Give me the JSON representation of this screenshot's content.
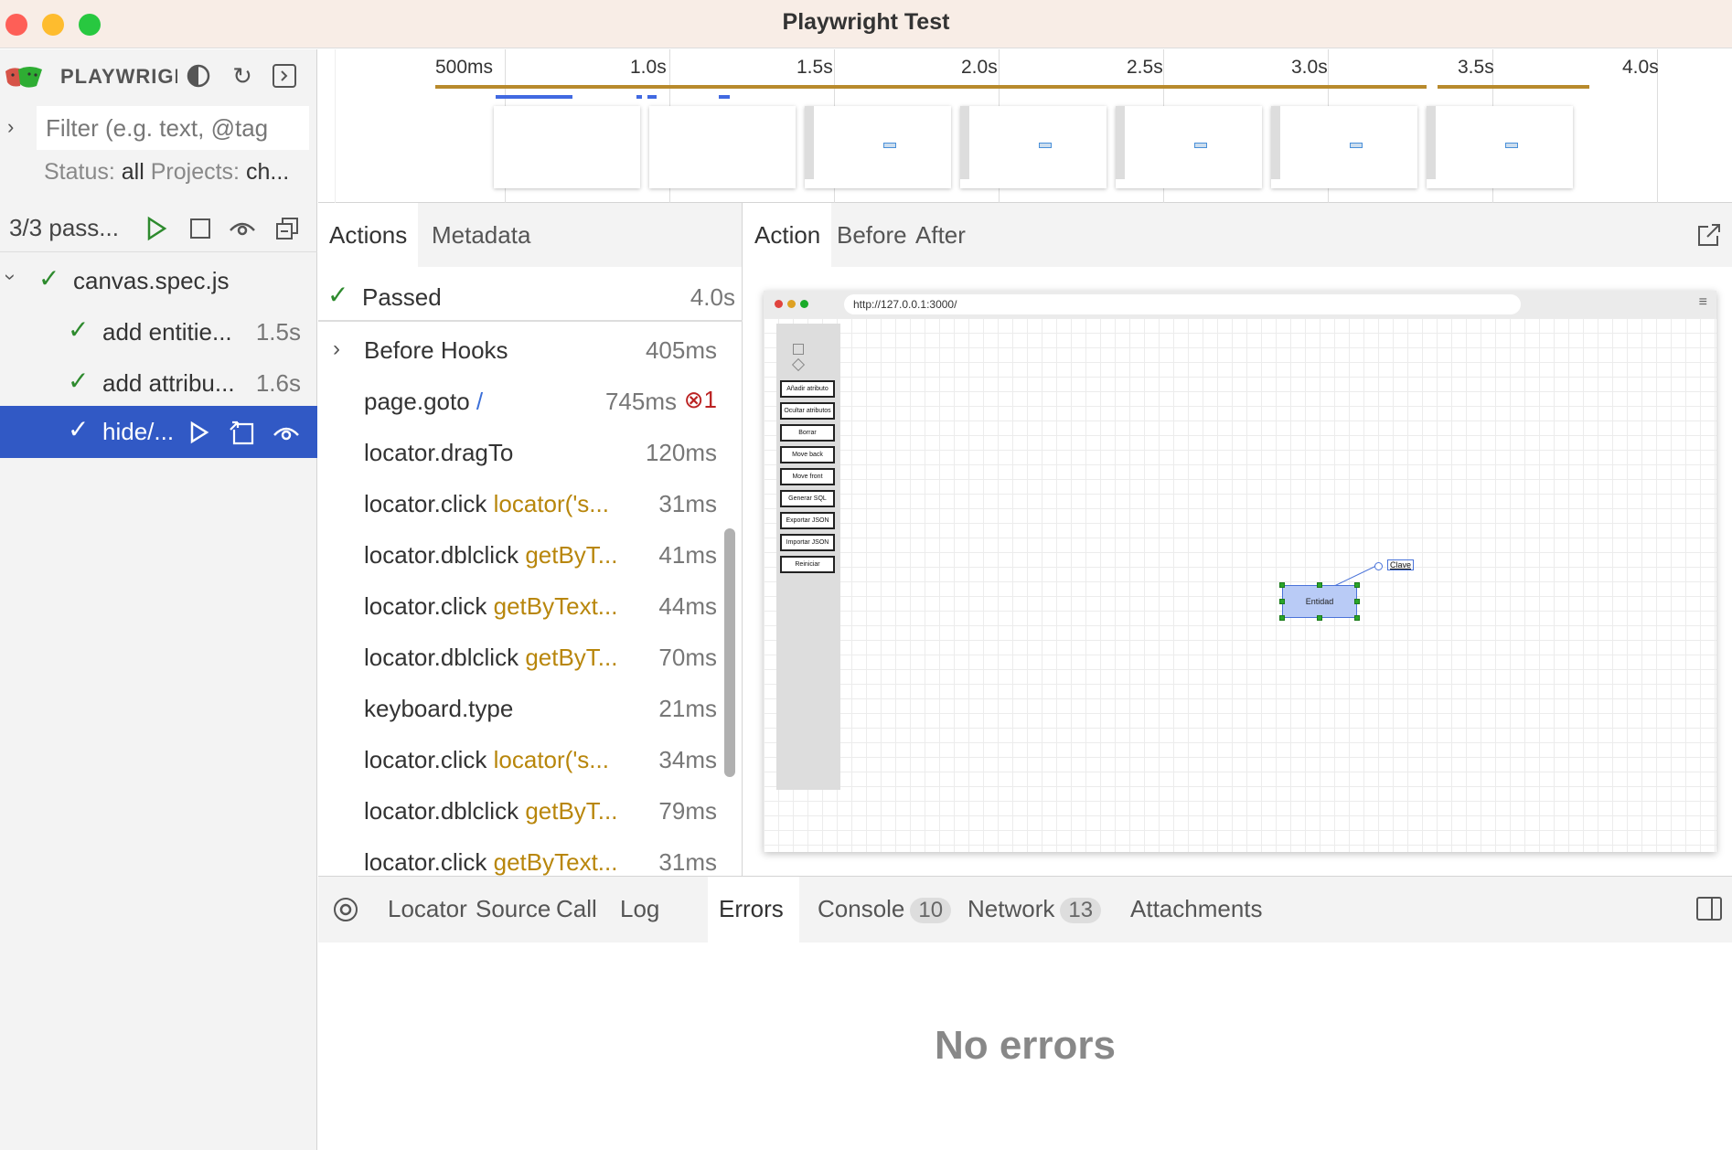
{
  "window": {
    "title": "Playwright Test"
  },
  "sidebar": {
    "brand": "PLAYWRIGHT",
    "filter": {
      "placeholder": "Filter (e.g. text, @tag",
      "value": ""
    },
    "status": {
      "status_label": "Status:",
      "status_value": "all",
      "projects_label": "Projects:",
      "projects_value": "ch..."
    },
    "run_summary": "3/3 pass...",
    "tree": [
      {
        "label": "canvas.spec.js",
        "duration": ""
      },
      {
        "label": "add entitie...",
        "duration": "1.5s"
      },
      {
        "label": "add attribu...",
        "duration": "1.6s"
      },
      {
        "label": "hide/...",
        "duration": ""
      }
    ]
  },
  "timeline": {
    "ticks": [
      "500ms",
      "1.0s",
      "1.5s",
      "2.0s",
      "2.5s",
      "3.0s",
      "3.5s",
      "4.0s"
    ]
  },
  "actions_panel": {
    "tabs": [
      "Actions",
      "Metadata"
    ],
    "passed": {
      "label": "Passed",
      "duration": "4.0s"
    },
    "rows": [
      {
        "name": "Before Hooks",
        "arg": "",
        "duration": "405ms",
        "expandable": true
      },
      {
        "name": "page.goto",
        "arg": "/",
        "duration": "745ms",
        "errors": "1"
      },
      {
        "name": "locator.dragTo",
        "arg": "",
        "duration": "120ms"
      },
      {
        "name": "locator.click",
        "arg": "locator('s...",
        "duration": "31ms"
      },
      {
        "name": "locator.dblclick",
        "arg": "getByT...",
        "duration": "41ms"
      },
      {
        "name": "locator.click",
        "arg": "getByText...",
        "duration": "44ms"
      },
      {
        "name": "locator.dblclick",
        "arg": "getByT...",
        "duration": "70ms"
      },
      {
        "name": "keyboard.type",
        "arg": "",
        "duration": "21ms"
      },
      {
        "name": "locator.click",
        "arg": "locator('s...",
        "duration": "34ms"
      },
      {
        "name": "locator.dblclick",
        "arg": "getByT...",
        "duration": "79ms"
      },
      {
        "name": "locator.click",
        "arg": "getByText...",
        "duration": "31ms"
      }
    ]
  },
  "snapshot": {
    "tabs": [
      "Action",
      "Before",
      "After"
    ],
    "url": "http://127.0.0.1:3000/",
    "toolbox_buttons": [
      "Añadir atributo",
      "Ocultar atributos",
      "Borrar",
      "Move back",
      "Move front",
      "Generar SQL",
      "Exportar JSON",
      "Importar JSON",
      "Reiniciar"
    ],
    "entity_label": "Entidad",
    "attribute_label": "Clave"
  },
  "bottom_panel": {
    "tabs": [
      {
        "label": "Locator"
      },
      {
        "label": "Source"
      },
      {
        "label": "Call"
      },
      {
        "label": "Log"
      },
      {
        "label": "Errors"
      },
      {
        "label": "Console",
        "count": "10"
      },
      {
        "label": "Network",
        "count": "13"
      },
      {
        "label": "Attachments"
      }
    ],
    "empty_message": "No errors"
  },
  "colors": {
    "accent": "#3159c5",
    "pass": "#2d8a2d",
    "selector": "#b8860b",
    "timeline_bar": "#b88a2c"
  },
  "icons": [
    "playwright-logo-icon",
    "theme-toggle-icon",
    "reload-icon",
    "collapse-sidebar-icon",
    "chevron-right-icon",
    "chevron-down-icon",
    "play-icon",
    "stop-icon",
    "watch-eye-icon",
    "collapse-all-icon",
    "check-icon",
    "open-trace-icon",
    "popout-icon",
    "target-icon",
    "split-layout-icon",
    "error-circle-icon"
  ]
}
